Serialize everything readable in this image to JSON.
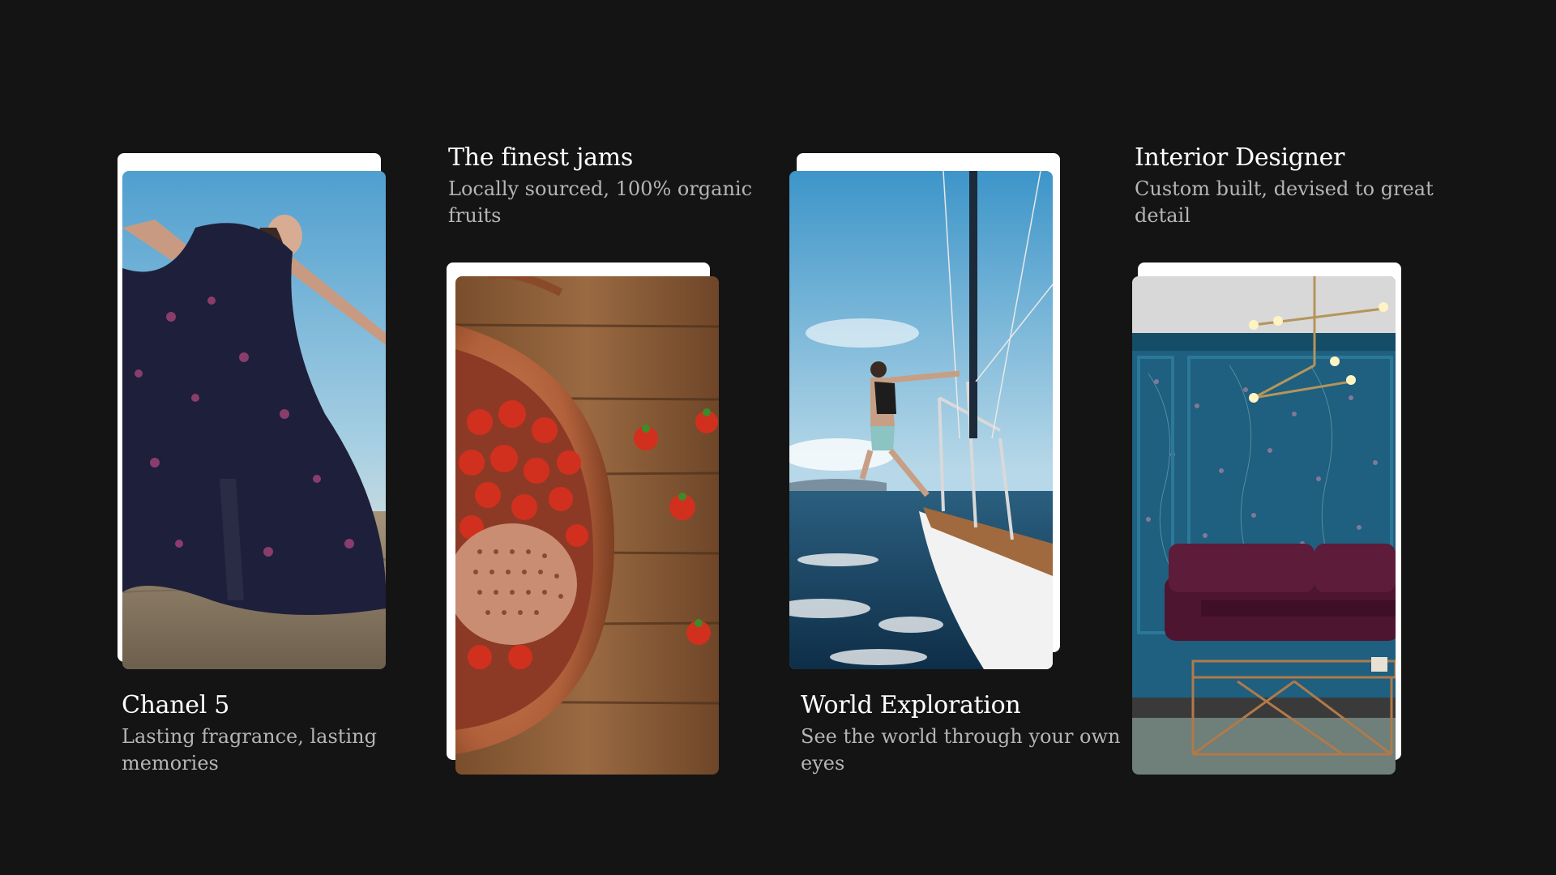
{
  "cards": [
    {
      "title": "Chanel 5",
      "subtitle": "Lasting fragrance, lasting memories",
      "image": "dancer-on-beach-photo"
    },
    {
      "title": "The finest jams",
      "subtitle": "Locally sourced, 100% organic fruits",
      "image": "strawberries-copper-pot-photo"
    },
    {
      "title": "World Exploration",
      "subtitle": "See the world through your own eyes",
      "image": "sailboat-ocean-photo"
    },
    {
      "title": "Interior Designer",
      "subtitle": "Custom built, devised to great detail",
      "image": "blue-wallpaper-room-photo"
    }
  ],
  "colors": {
    "background": "#141414",
    "card_backplate": "#ffffff",
    "title": "#ffffff",
    "subtitle": "#b5b5b5"
  }
}
